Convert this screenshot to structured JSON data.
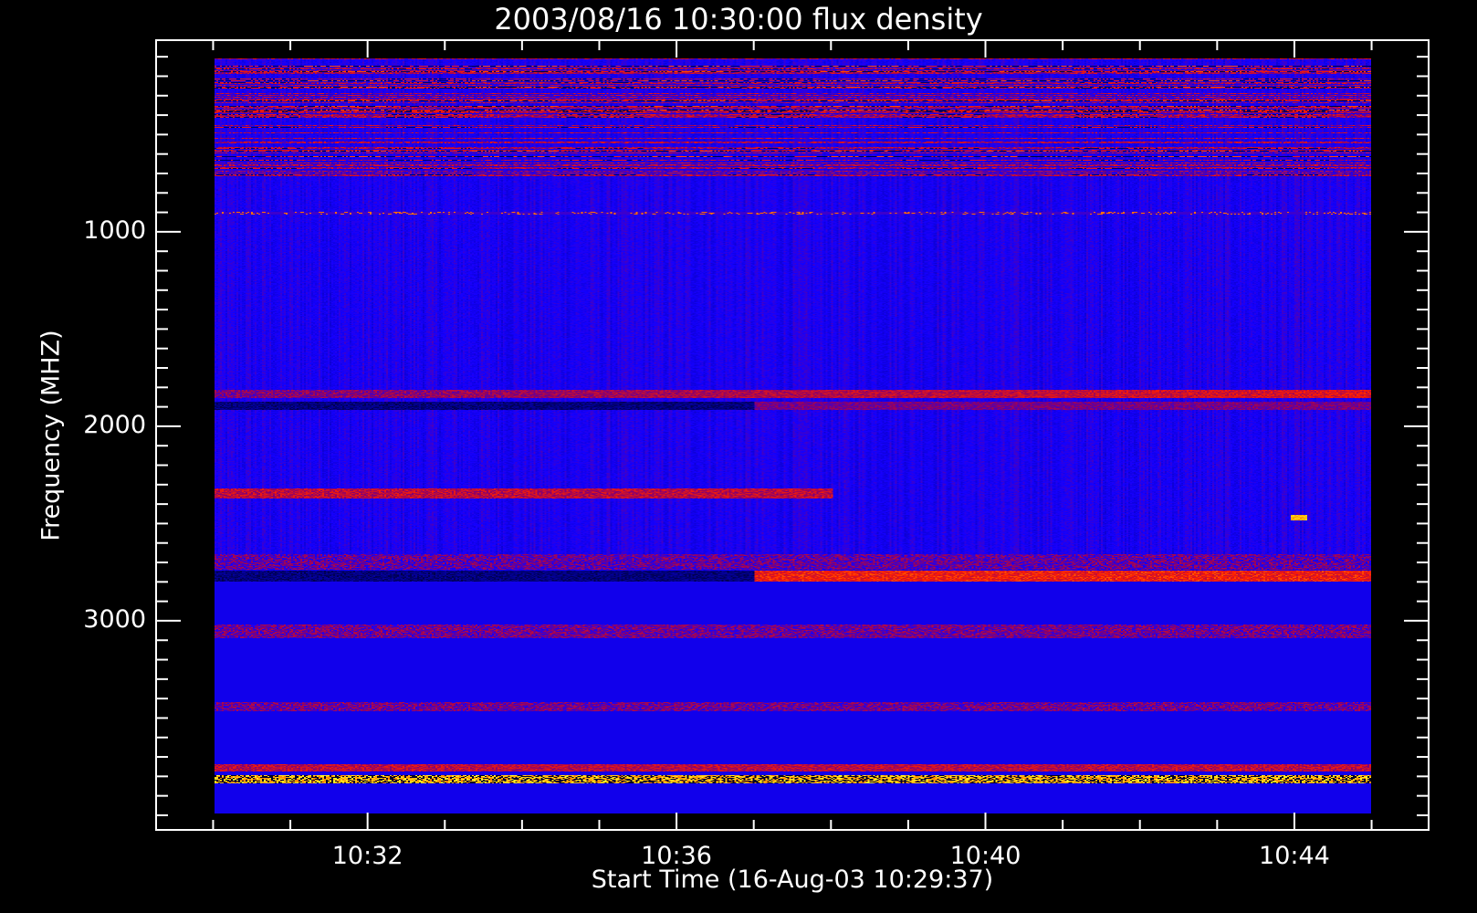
{
  "chart_data": {
    "type": "heatmap",
    "title": "2003/08/16 10:30:00 flux density",
    "xlabel": "Start Time (16-Aug-03 10:29:37)",
    "ylabel": "Frequency (MHZ)",
    "x_unit": "minutes after 10:30:00",
    "xlim": [
      -0.75,
      15.75
    ],
    "ylim": [
      4080,
      10
    ],
    "data_extent": {
      "time_minutes": [
        0,
        15
      ],
      "frequency_mhz": [
        100,
        4000
      ]
    },
    "x_ticks": [
      {
        "value": 2,
        "label": "10:32"
      },
      {
        "value": 6,
        "label": "10:36"
      },
      {
        "value": 10,
        "label": "10:40"
      },
      {
        "value": 14,
        "label": "10:44"
      }
    ],
    "x_minor_step": 1,
    "y_ticks": [
      {
        "value": 1000,
        "label": "1000"
      },
      {
        "value": 2000,
        "label": "2000"
      },
      {
        "value": 3000,
        "label": "3000"
      }
    ],
    "y_minor_step": 100,
    "colormap": [
      "#000000",
      "#1400ee",
      "#0000ff",
      "#c00000",
      "#ff2000",
      "#ff9000",
      "#ffff40"
    ],
    "background_level": 0.3,
    "features": [
      {
        "name": "low-band-striped-interference",
        "f": [
          100,
          720
        ],
        "t": [
          0,
          15
        ],
        "level": 0.55,
        "kind": "stripes"
      },
      {
        "name": "dotted-line-900",
        "f": [
          890,
          905
        ],
        "t": [
          0,
          15
        ],
        "level": 0.5,
        "kind": "dotted"
      },
      {
        "name": "band-1830-red",
        "f": [
          1810,
          1850
        ],
        "t": [
          0,
          15
        ],
        "level": 0.62,
        "kind": "rising"
      },
      {
        "name": "band-1900-dark-then-red",
        "f": [
          1870,
          1915
        ],
        "t": [
          0,
          15
        ],
        "level": 0.45,
        "kind": "dark-to-red"
      },
      {
        "name": "band-2340-red",
        "f": [
          2320,
          2370
        ],
        "t": [
          0,
          8
        ],
        "level": 0.55,
        "kind": "noisy"
      },
      {
        "name": "burst-2470",
        "f": [
          2455,
          2485
        ],
        "t": [
          13.95,
          14.15
        ],
        "level": 0.95,
        "kind": "solid"
      },
      {
        "name": "band-2700-noisy",
        "f": [
          2660,
          2740
        ],
        "t": [
          0,
          15
        ],
        "level": 0.4,
        "kind": "noisy"
      },
      {
        "name": "band-2775-dark-then-red",
        "f": [
          2745,
          2800
        ],
        "t": [
          0,
          15
        ],
        "level": 0.7,
        "kind": "dark-to-red"
      },
      {
        "name": "band-3050-dim",
        "f": [
          3020,
          3090
        ],
        "t": [
          0,
          15
        ],
        "level": 0.42,
        "kind": "noisy"
      },
      {
        "name": "band-3450-dim",
        "f": [
          3420,
          3470
        ],
        "t": [
          0,
          15
        ],
        "level": 0.42,
        "kind": "noisy"
      },
      {
        "name": "band-3760-red",
        "f": [
          3745,
          3780
        ],
        "t": [
          0,
          15
        ],
        "level": 0.55,
        "kind": "noisy"
      },
      {
        "name": "band-3820-yellow-stripes",
        "f": [
          3800,
          3840
        ],
        "t": [
          0,
          15
        ],
        "level": 0.85,
        "kind": "flicker"
      }
    ]
  }
}
